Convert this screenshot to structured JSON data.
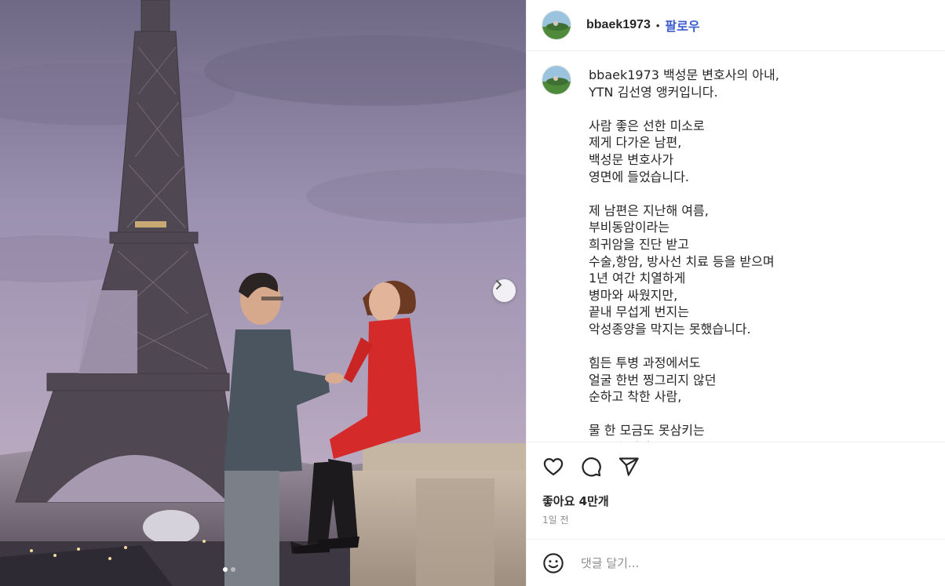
{
  "post": {
    "username": "bbaek1973",
    "separator": "•",
    "follow_label": "팔로우",
    "dots_count": 2
  },
  "caption": {
    "username": "bbaek1973",
    "text": " 백성문 변호사의 아내,\nYTN 김선영 앵커입니다.\n\n사람 좋은 선한 미소로\n제게 다가온 남편,\n백성문 변호사가\n영면에 들었습니다.\n\n제 남편은 지난해 여름,\n부비동암이라는\n희귀암을 진단 받고\n수술,항암, 방사선 치료 등을 받으며\n1년 여간 치열하게\n병마와 싸웠지만,\n끝내 무섭게 번지는\n악성종양을 막지는 못했습니다.\n\n힘든 투병 과정에서도\n얼굴 한번 찡그리지 않던\n순하고 착한 사람,\n\n물 한 모금도 못삼키는\n고통 속에서도"
  },
  "stats": {
    "likes": "좋아요 4만개",
    "time": "1일 전"
  },
  "comment": {
    "placeholder": "댓글 달기..."
  },
  "icons": {
    "like": "heart-icon",
    "comment": "comment-icon",
    "share": "share-icon",
    "emoji": "emoji-icon",
    "next": "chevron-right-icon"
  },
  "colors": {
    "follow": "#3b5bcf",
    "sky": "#8f86a3",
    "dress": "#d42a2a"
  }
}
